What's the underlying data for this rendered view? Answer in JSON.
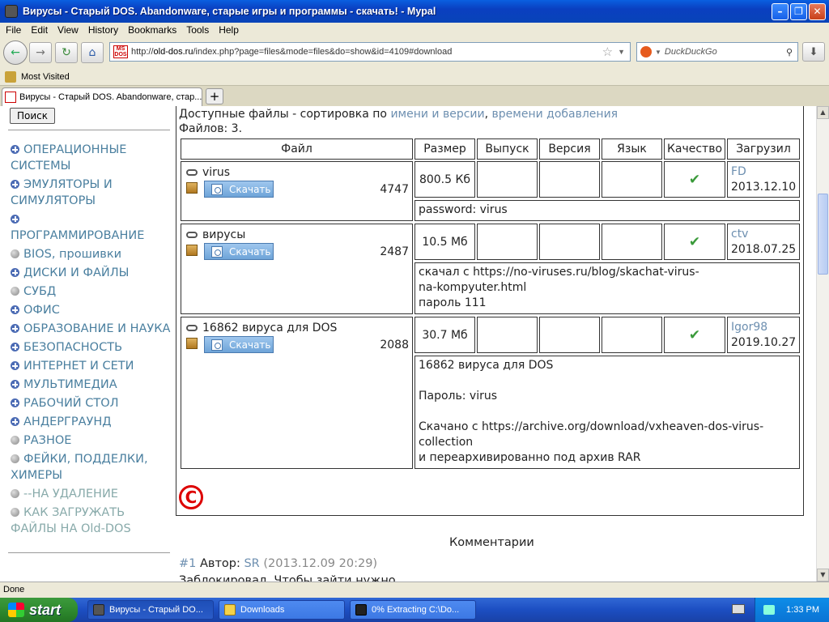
{
  "window": {
    "title": "Вирусы - Старый DOS. Abandonware, старые игры и программы - скачать! - Mypal"
  },
  "menu": [
    "File",
    "Edit",
    "View",
    "History",
    "Bookmarks",
    "Tools",
    "Help"
  ],
  "nav": {
    "url_prefix": "http://",
    "url_domain": "old-dos.ru",
    "url_rest": "/index.php?page=files&mode=files&do=show&id=4109#download",
    "search_engine": "DuckDuckGo"
  },
  "bookmarks": {
    "most_visited": "Most Visited"
  },
  "tab": {
    "label": "Вирусы - Старый DOS. Abandonware, стар...",
    "new_tab": "+"
  },
  "page": {
    "search_button": "Поиск",
    "sidebar": [
      {
        "label": "ОПЕРАЦИОННЫЕ СИСТЕМЫ",
        "bullet": "plus"
      },
      {
        "label": "ЭМУЛЯТОРЫ И СИМУЛЯТОРЫ",
        "bullet": "plus"
      },
      {
        "label": "ПРОГРАММИРОВАНИЕ",
        "bullet": "plus"
      },
      {
        "label": "BIOS, прошивки",
        "bullet": "dot"
      },
      {
        "label": "ДИСКИ И ФАЙЛЫ",
        "bullet": "plus"
      },
      {
        "label": "СУБД",
        "bullet": "dot"
      },
      {
        "label": "ОФИС",
        "bullet": "plus"
      },
      {
        "label": "ОБРАЗОВАНИЕ И НАУКА",
        "bullet": "plus"
      },
      {
        "label": "БЕЗОПАСНОСТЬ",
        "bullet": "plus"
      },
      {
        "label": "ИНТЕРНЕТ И СЕТИ",
        "bullet": "plus"
      },
      {
        "label": "МУЛЬТИМЕДИА",
        "bullet": "plus"
      },
      {
        "label": "РАБОЧИЙ СТОЛ",
        "bullet": "plus"
      },
      {
        "label": "АНДЕРГРАУНД",
        "bullet": "plus"
      },
      {
        "label": "РАЗНОЕ",
        "bullet": "dot"
      },
      {
        "label": "ФЕЙКИ, ПОДДЕЛКИ, ХИМЕРЫ",
        "bullet": "dot"
      },
      {
        "label": "--НА УДАЛЕНИЕ",
        "bullet": "dot"
      },
      {
        "label": "КАК ЗАГРУЖАТЬ ФАЙЛЫ НА Old-DOS",
        "bullet": "dot"
      }
    ],
    "available_prefix": "Доступные файлы - сортировка по ",
    "sort_by_name": "имени и версии",
    "sort_sep": ", ",
    "sort_by_time": "времени добавления",
    "files_count": "Файлов: 3.",
    "columns": [
      "Файл",
      "Размер",
      "Выпуск",
      "Версия",
      "Язык",
      "Качество",
      "Загрузил"
    ],
    "download_label": "Скачать",
    "files": [
      {
        "name": "virus",
        "downloads": "4747",
        "size": "800.5 Кб",
        "uploader": "FD",
        "date": "2013.12.10",
        "note": "password: virus"
      },
      {
        "name": "вирусы",
        "downloads": "2487",
        "size": "10.5 Мб",
        "uploader": "ctv",
        "date": "2018.07.25",
        "note": "скачал с https://no-viruses.ru/blog/skachat-virus-\nna-kompyuter.html\nпароль 111"
      },
      {
        "name": "16862 вируса для DOS",
        "downloads": "2088",
        "size": "30.7 Мб",
        "uploader": "Igor98",
        "date": "2019.10.27",
        "note": "16862 вируса для DOS\n\nПароль: virus\n\nСкачано с https://archive.org/download/vxheaven-dos-virus-\ncollection\nи переархивированно под архив RAR"
      }
    ],
    "comments_heading": "Комментарии",
    "comment": {
      "number": "#1",
      "author_label": " Автор: ",
      "author": "SR",
      "time": " (2013.12.09 20:29)"
    },
    "clipped_text": "Заблокировал. Чтобы зайти нужно"
  },
  "status": {
    "text": "Done"
  },
  "taskbar": {
    "start": "start",
    "items": [
      "Вирусы - Старый DO...",
      "Downloads",
      "0% Extracting C:\\Do..."
    ],
    "clock": "1:33 PM"
  }
}
